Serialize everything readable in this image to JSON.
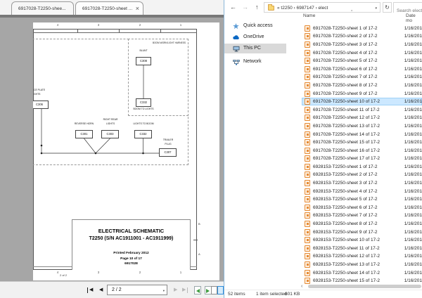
{
  "pdf_viewer": {
    "tabs": [
      {
        "label": "6917028-T2250-shee..."
      },
      {
        "label": "6917028-T2250-sheet ...",
        "close_glyph": "×"
      }
    ],
    "toolbar": {
      "first_glyph": "◀",
      "prev_glyph": "◀",
      "next_glyph": "▶",
      "last_glyph": "▶",
      "page_indicator": "2 / 2",
      "combo_caret": "▾"
    },
    "page": {
      "sheet_label": "2 of 2",
      "ruler_top": [
        "4",
        "3",
        "2",
        "1"
      ],
      "ruler_bottom": [
        "4",
        "3",
        "2",
        "1"
      ],
      "grid_row_letters": [
        "B",
        "A"
      ],
      "schematic": {
        "boom_harness": "BOOM WORK/LIGHT HARNESS",
        "blunt": "BLUNT",
        "c308": "C308",
        "c332_upper": "C332",
        "boom_to_lights": "BOOM TO LIGHTS",
        "plate_line1": "CE PLATE",
        "plate_line2": "GHTS",
        "c306": "C306",
        "reverse_horn": "REVERSE HORN",
        "c301": "C301",
        "right_rear_line1": "RIGHT REAR",
        "right_rear_line2": "LIGHTS",
        "c303": "C303",
        "lights_to_boom": "LIGHTS TO BOOM",
        "c332_lower": "C332",
        "trailer_line1": "TRAILER",
        "trailer_line2": "PLUG",
        "c307": "C307"
      },
      "title_block": {
        "title": "ELECTRICAL SCHEMATIC",
        "subtitle": "T2250 (S/N AC1911001 - AC1911999)",
        "printed": "Printed February 2012",
        "page_of": "Page 10 of 17",
        "doc_number": "6917028"
      }
    }
  },
  "explorer": {
    "toolbar": {
      "back_glyph": "←",
      "forward_glyph": "→",
      "up_glyph": "↑",
      "address": "« t2250 › 6987147 › elect",
      "address_caret": "▾",
      "refresh_glyph": "↻",
      "search_placeholder": "Search elect"
    },
    "sidebar": [
      {
        "label": "Quick access"
      },
      {
        "label": "OneDrive"
      },
      {
        "label": "This PC"
      },
      {
        "label": "Network"
      }
    ],
    "columns": {
      "name": "Name",
      "date": "Date mo",
      "sort_glyph": "^"
    },
    "scroll_left_glyph": "‹",
    "files": [
      {
        "name": "6917028-T2250-sheet 1 of 17-2",
        "date": "1/16/201",
        "selected": false
      },
      {
        "name": "6917028-T2250-sheet 2 of 17-2",
        "date": "1/16/201",
        "selected": false
      },
      {
        "name": "6917028-T2250-sheet 3 of 17-2",
        "date": "1/16/201",
        "selected": false
      },
      {
        "name": "6917028-T2250-sheet 4 of 17-2",
        "date": "1/16/201",
        "selected": false
      },
      {
        "name": "6917028-T2250-sheet 5 of 17-2",
        "date": "1/16/201",
        "selected": false
      },
      {
        "name": "6917028-T2250-sheet 6 of 17-2",
        "date": "1/16/201",
        "selected": false
      },
      {
        "name": "6917028-T2250-sheet 7 of 17-2",
        "date": "1/16/201",
        "selected": false
      },
      {
        "name": "6917028-T2250-sheet 8 of 17-2",
        "date": "1/16/201",
        "selected": false
      },
      {
        "name": "6917028-T2250-sheet 9 of 17-2",
        "date": "1/16/201",
        "selected": false
      },
      {
        "name": "6917028-T2250-sheet 10 of 17-2",
        "date": "1/16/201",
        "selected": true
      },
      {
        "name": "6917028-T2250-sheet 11 of 17-2",
        "date": "1/16/201",
        "selected": false
      },
      {
        "name": "6917028-T2250-sheet 12 of 17-2",
        "date": "1/16/201",
        "selected": false
      },
      {
        "name": "6917028-T2250-sheet 13 of 17-2",
        "date": "1/16/201",
        "selected": false
      },
      {
        "name": "6917028-T2250-sheet 14 of 17-2",
        "date": "1/16/201",
        "selected": false
      },
      {
        "name": "6917028-T2250-sheet 15 of 17-2",
        "date": "1/16/201",
        "selected": false
      },
      {
        "name": "6917028-T2250-sheet 16 of 17-2",
        "date": "1/16/201",
        "selected": false
      },
      {
        "name": "6917028-T2250-sheet 17 of 17-2",
        "date": "1/16/201",
        "selected": false
      },
      {
        "name": "6928153-T2250-sheet 1 of 17-2",
        "date": "1/16/201",
        "selected": false
      },
      {
        "name": "6928153-T2250-sheet 2 of 17-2",
        "date": "1/16/201",
        "selected": false
      },
      {
        "name": "6928153-T2250-sheet 3 of 17-2",
        "date": "1/16/201",
        "selected": false
      },
      {
        "name": "6928153-T2250-sheet 4 of 17-2",
        "date": "1/16/201",
        "selected": false
      },
      {
        "name": "6928153-T2250-sheet 5 of 17-2",
        "date": "1/16/201",
        "selected": false
      },
      {
        "name": "6928153-T2250-sheet 6 of 17-2",
        "date": "1/16/201",
        "selected": false
      },
      {
        "name": "6928153-T2250-sheet 7 of 17-2",
        "date": "1/16/201",
        "selected": false
      },
      {
        "name": "6928153-T2250-sheet 8 of 17-2",
        "date": "1/16/201",
        "selected": false
      },
      {
        "name": "6928153-T2250-sheet 9 of 17-2",
        "date": "1/16/201",
        "selected": false
      },
      {
        "name": "6928153-T2250-sheet 10 of 17-2",
        "date": "1/16/201",
        "selected": false
      },
      {
        "name": "6928153-T2250-sheet 11 of 17-2",
        "date": "1/16/201",
        "selected": false
      },
      {
        "name": "6928153-T2250-sheet 12 of 17-2",
        "date": "1/16/201",
        "selected": false
      },
      {
        "name": "6928153-T2250-sheet 13 of 17-2",
        "date": "1/16/201",
        "selected": false
      },
      {
        "name": "6928153-T2250-sheet 14 of 17-2",
        "date": "1/16/201",
        "selected": false
      },
      {
        "name": "6928153-T2250-sheet 15 of 17-2",
        "date": "1/16/201",
        "selected": false
      }
    ],
    "status": {
      "items_count": "52 items",
      "selection": "1 item selected",
      "selection_size": "601 KB"
    }
  }
}
